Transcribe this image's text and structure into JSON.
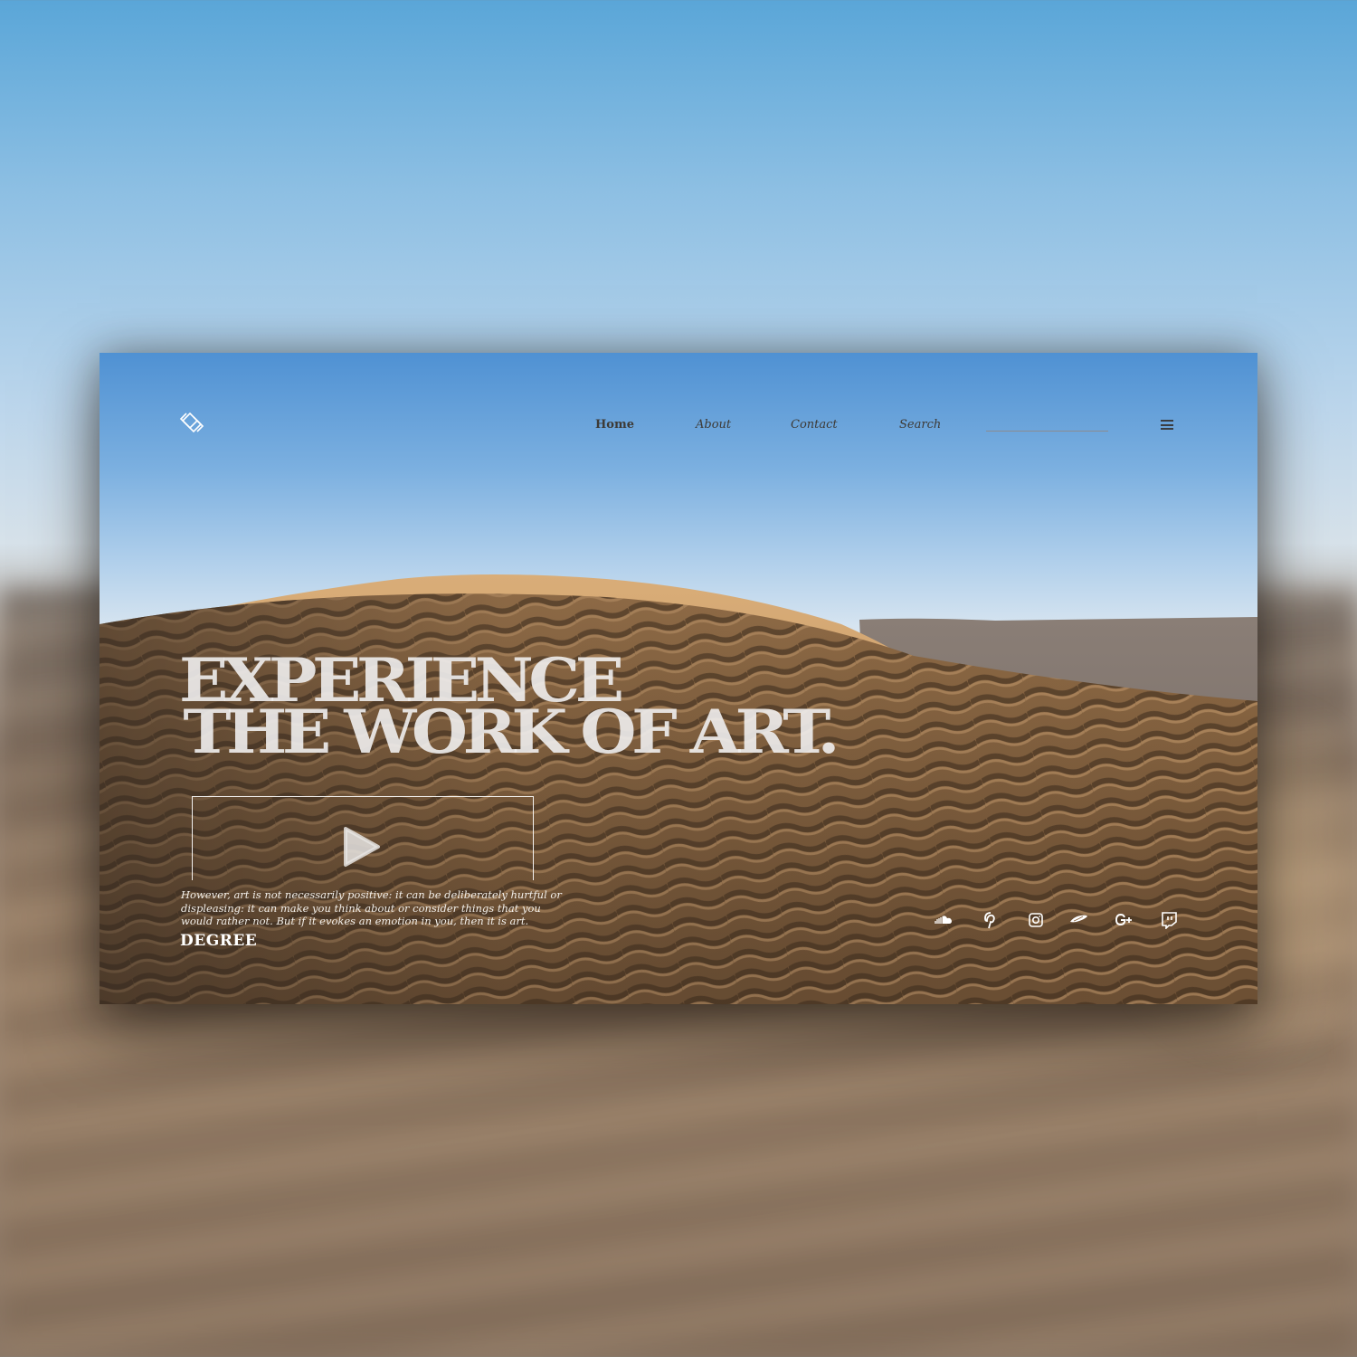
{
  "nav": {
    "logo_icon": "diamond-logo-icon",
    "links": [
      "Home",
      "About",
      "Contact",
      "Search"
    ],
    "active": "Home",
    "search_value": "",
    "menu_icon": "hamburger-menu-icon"
  },
  "hero": {
    "headline_line1": "EXPERIENCE",
    "headline_line2": "THE WORK OF ART.",
    "play_icon": "play-icon",
    "description": "However, art is not necessarily positive: it can be deliberately hurtful or displeasing: it can make you think about or consider things that you would rather not. But if it evokes an emotion in you, then it is art.",
    "brand": "DEGREE"
  },
  "social_icons": [
    "soundcloud-icon",
    "pinterest-icon",
    "instagram-icon",
    "codepen-icon",
    "google-plus-icon",
    "twitch-icon"
  ],
  "colors": {
    "sky_top": "#4f91d3",
    "sand": "#b98b5c",
    "nav_text": "#3d3a36",
    "headline": "#f0eeee"
  }
}
